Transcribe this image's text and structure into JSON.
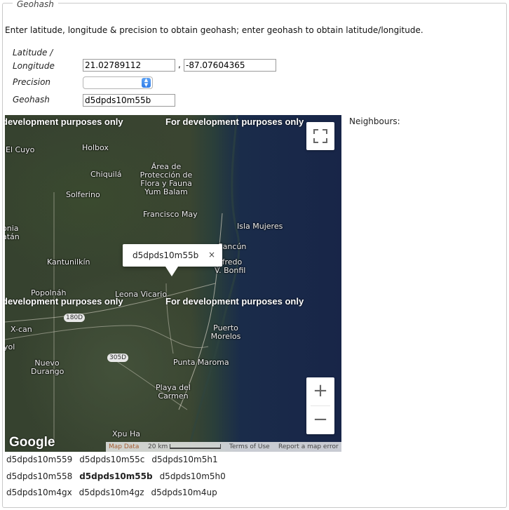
{
  "legend": "Geohash",
  "intro": "Enter latitude, longitude & precision to obtain geohash; enter geohash to obtain latitude/longitude.",
  "form": {
    "latlon_label": "Latitude / Longitude",
    "latitude_value": "21.02789112",
    "comma": ",",
    "longitude_value": "-87.07604365",
    "precision_label": "Precision",
    "precision_value": "",
    "geohash_label": "Geohash",
    "geohash_value": "d5dpds10m55b"
  },
  "neighbours_label": "Neighbours:",
  "map": {
    "dev_watermark": "For development purposes only",
    "dev_watermark_clipped": "development purposes only",
    "places": [
      "El Cuyo",
      "Holbox",
      "Chiquilá",
      "Solferino",
      "Área de Protección de Flora y Fauna Yum Balam",
      "Francisco May",
      "Isla Mujeres",
      "Cancún",
      "Alfredo V. Bonfil",
      "Kantunilkín",
      "Popolnáh",
      "Leona Vicario",
      "X-can",
      "Puerto Morelos",
      "Nuevo Durango",
      "Punta Maroma",
      "Playa del Carmen",
      "Xpu Ha",
      "onia atán",
      "yol"
    ],
    "roads": [
      "180D",
      "305D"
    ],
    "infowindow_text": "d5dpds10m55b",
    "infowindow_close": "×",
    "zoom_in": "+",
    "zoom_out": "−",
    "google_logo": "Google",
    "map_data": "Map Data",
    "scale": "20 km",
    "terms": "Terms of Use",
    "report": "Report a map error"
  },
  "neighbours": [
    [
      "d5dpds10m559",
      "d5dpds10m55c",
      "d5dpds10m5h1"
    ],
    [
      "d5dpds10m558",
      "d5dpds10m55b",
      "d5dpds10m5h0"
    ],
    [
      "d5dpds10m4gx",
      "d5dpds10m4gz",
      "d5dpds10m4up"
    ]
  ],
  "colors": {
    "land": "#3a4531",
    "sea": "#182548",
    "map_data_link": "#a55a2f"
  }
}
